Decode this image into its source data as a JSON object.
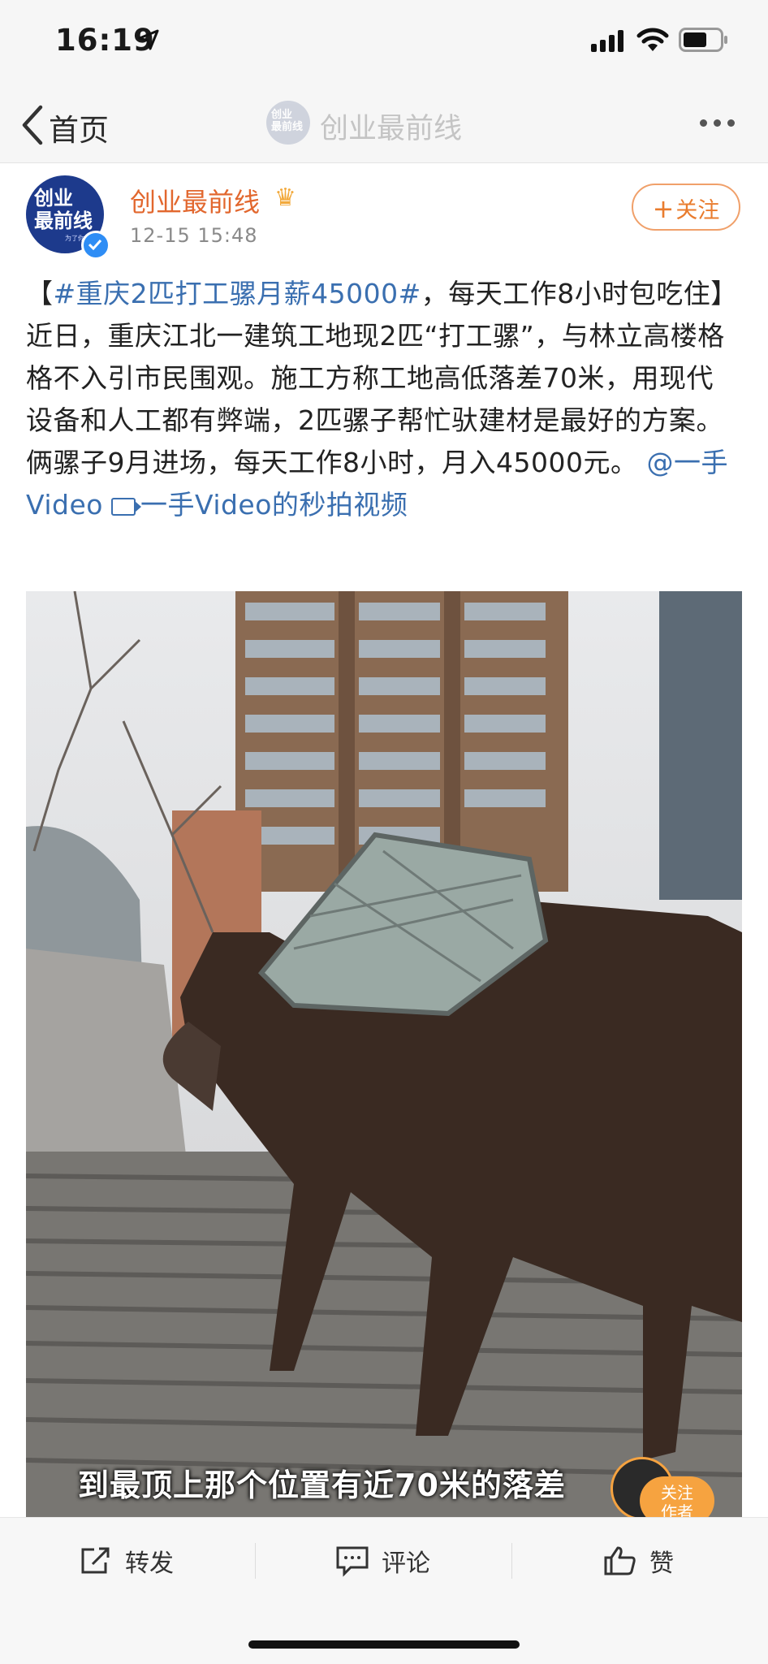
{
  "status_bar": {
    "time": "16:19",
    "location_icon": "location-arrow-icon",
    "signal_icon": "signal-icon",
    "wifi_icon": "wifi-icon",
    "battery_icon": "battery-icon"
  },
  "nav": {
    "back_label": "首页",
    "title": "创业最前线",
    "more_icon": "more-icon"
  },
  "author": {
    "avatar_text_line1": "创业",
    "avatar_text_line2": "最前线",
    "avatar_small": "为了你",
    "name": "创业最前线",
    "badge_icon": "crown-icon",
    "time": "12-15 15:48",
    "follow_label": "关注"
  },
  "post": {
    "open_bracket": "【",
    "hashtag": "#重庆2匹打工骡月薪45000#",
    "body1": "，每天工作8小时包吃住】近日，重庆江北一建筑工地现2匹“打工骡”，与林立高楼格格不入引市民围观。施工方称工地高低落差70米，用现代设备和人工都有弊端，2匹骡子帮忙驮建材是最好的方案。俩骡子9月进场，每天工作8小时，月入45000元。",
    "mention": "@一手Video",
    "video_link": "一手Video的秒拍视频"
  },
  "video": {
    "caption": "到最顶上那个位置有近70米的落差",
    "follow_author_label1": "关注",
    "follow_author_label2": "作者"
  },
  "actions": {
    "repost_label": "转发",
    "comment_label": "评论",
    "like_label": "赞"
  },
  "colors": {
    "accent_orange": "#e97c2e",
    "link_blue": "#3a6fb0",
    "verified_blue": "#2e8df5"
  }
}
